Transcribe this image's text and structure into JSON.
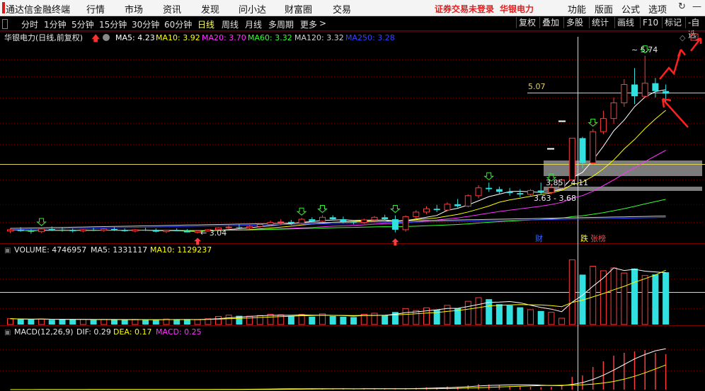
{
  "menubar": {
    "app_title": "通达信金融终端",
    "items": [
      "行情",
      "市场",
      "资讯",
      "发现",
      "问小达",
      "财富圈",
      "交易"
    ],
    "status_login": "证券交易未登录",
    "status_stock": "华银电力",
    "right_items": [
      "功能",
      "版面",
      "公式",
      "选项"
    ]
  },
  "toolbar": {
    "periods": [
      "分时",
      "1分钟",
      "5分钟",
      "15分钟",
      "30分钟",
      "60分钟",
      "日线",
      "周线",
      "月线",
      "多周期",
      "更多"
    ],
    "active_period": "日线",
    "more_arrow": ">",
    "buttons": [
      "复权",
      "叠加",
      "多股",
      "统计",
      "画线",
      "F10",
      "标记",
      "-自选"
    ]
  },
  "main_panel": {
    "title": "华银电力(日线,前复权)",
    "ma": [
      {
        "label": "MA5: 4.23",
        "color": "#ffffff"
      },
      {
        "label": "MA10: 3.92",
        "color": "#ffff00"
      },
      {
        "label": "MA20: 3.70",
        "color": "#ff33ff"
      },
      {
        "label": "MA60: 3.32",
        "color": "#33ff33"
      },
      {
        "label": "MA120: 3.32",
        "color": "#d0d0d0"
      },
      {
        "label": "MA250: 3.28",
        "color": "#3344ff"
      }
    ],
    "labels": {
      "high": "5.74",
      "low": "3.04",
      "hline_price": "5.07",
      "zone_upper": "3.85 - 4.11",
      "zone_lower": "3.63 - 3.68",
      "tag_fin": "财",
      "tag_die": "跌",
      "tag_zhang": "张榜"
    }
  },
  "volume_panel": {
    "label": "VOLUME: 4746957",
    "ma5": "MA5: 1331117",
    "ma10": "MA10: 1129237"
  },
  "macd_panel": {
    "label": "MACD(12,26,9)",
    "dif": "DIF: 0.29",
    "dea": "DEA: 0.17",
    "macd": "MACD: 0.25"
  },
  "colors": {
    "up": "#ff3b3b",
    "down": "#33e0e0",
    "ma5": "#ffffff",
    "ma10": "#ffff00",
    "ma20": "#ff33ff",
    "ma60": "#33ff33",
    "ma120": "#d0d0d0",
    "ma250": "#3344ff",
    "panel_border": "#7a0000",
    "signal": "#33ee33"
  },
  "chart_data": {
    "type": "candlestick",
    "candles": [
      [
        3.06,
        3.1,
        3.03,
        3.08
      ],
      [
        3.08,
        3.12,
        3.05,
        3.06
      ],
      [
        3.06,
        3.09,
        3.02,
        3.05
      ],
      [
        3.05,
        3.1,
        3.03,
        3.09
      ],
      [
        3.09,
        3.13,
        3.06,
        3.08
      ],
      [
        3.08,
        3.11,
        3.05,
        3.07
      ],
      [
        3.07,
        3.1,
        3.04,
        3.06
      ],
      [
        3.06,
        3.09,
        3.04,
        3.08
      ],
      [
        3.08,
        3.11,
        3.06,
        3.07
      ],
      [
        3.07,
        3.1,
        3.05,
        3.09
      ],
      [
        3.09,
        3.12,
        3.06,
        3.07
      ],
      [
        3.07,
        3.1,
        3.05,
        3.06
      ],
      [
        3.06,
        3.09,
        3.04,
        3.08
      ],
      [
        3.08,
        3.11,
        3.06,
        3.07
      ],
      [
        3.07,
        3.1,
        3.04,
        3.05
      ],
      [
        3.05,
        3.08,
        3.03,
        3.07
      ],
      [
        3.07,
        3.1,
        3.06,
        3.06
      ],
      [
        3.06,
        3.09,
        3.04,
        3.04
      ],
      [
        3.04,
        3.07,
        3.02,
        3.06
      ],
      [
        3.06,
        3.09,
        3.05,
        3.08
      ],
      [
        3.08,
        3.12,
        3.07,
        3.11
      ],
      [
        3.11,
        3.15,
        3.09,
        3.12
      ],
      [
        3.12,
        3.16,
        3.1,
        3.11
      ],
      [
        3.11,
        3.15,
        3.09,
        3.13
      ],
      [
        3.13,
        3.18,
        3.11,
        3.16
      ],
      [
        3.16,
        3.22,
        3.14,
        3.19
      ],
      [
        3.19,
        3.24,
        3.16,
        3.2
      ],
      [
        3.2,
        3.23,
        3.15,
        3.18
      ],
      [
        3.18,
        3.26,
        3.17,
        3.24
      ],
      [
        3.24,
        3.27,
        3.2,
        3.21
      ],
      [
        3.21,
        3.3,
        3.2,
        3.27
      ],
      [
        3.27,
        3.3,
        3.22,
        3.24
      ],
      [
        3.24,
        3.28,
        3.18,
        3.2
      ],
      [
        3.2,
        3.23,
        3.16,
        3.19
      ],
      [
        3.19,
        3.25,
        3.17,
        3.23
      ],
      [
        3.23,
        3.29,
        3.21,
        3.27
      ],
      [
        3.27,
        3.31,
        3.22,
        3.24
      ],
      [
        3.24,
        3.3,
        3.04,
        3.08
      ],
      [
        3.08,
        3.3,
        3.05,
        3.28
      ],
      [
        3.28,
        3.38,
        3.25,
        3.35
      ],
      [
        3.35,
        3.44,
        3.32,
        3.4
      ],
      [
        3.4,
        3.46,
        3.35,
        3.38
      ],
      [
        3.38,
        3.5,
        3.36,
        3.47
      ],
      [
        3.47,
        3.55,
        3.42,
        3.44
      ],
      [
        3.44,
        3.62,
        3.42,
        3.6
      ],
      [
        3.6,
        3.76,
        3.56,
        3.72
      ],
      [
        3.72,
        3.8,
        3.66,
        3.7
      ],
      [
        3.7,
        3.74,
        3.62,
        3.66
      ],
      [
        3.66,
        3.72,
        3.6,
        3.64
      ],
      [
        3.64,
        3.7,
        3.58,
        3.62
      ],
      [
        3.62,
        3.7,
        3.6,
        3.68
      ],
      [
        3.68,
        3.8,
        3.62,
        3.65
      ],
      [
        3.65,
        3.78,
        3.62,
        3.72
      ],
      [
        3.72,
        3.86,
        3.7,
        3.84
      ],
      [
        3.84,
        4.48,
        3.84,
        4.48
      ],
      [
        4.48,
        4.5,
        4.02,
        4.1
      ],
      [
        4.1,
        4.62,
        4.08,
        4.58
      ],
      [
        4.58,
        4.9,
        4.54,
        4.78
      ],
      [
        4.78,
        5.1,
        4.7,
        5.02
      ],
      [
        5.02,
        5.38,
        4.96,
        5.3
      ],
      [
        5.3,
        5.55,
        5.0,
        5.12
      ],
      [
        5.12,
        5.74,
        5.1,
        5.32
      ],
      [
        5.32,
        5.4,
        5.1,
        5.2
      ],
      [
        5.2,
        5.3,
        5.02,
        5.16
      ]
    ],
    "volume": [
      6.8,
      6.2,
      5.9,
      6.5,
      5.6,
      6.0,
      5.8,
      6.1,
      5.3,
      5.9,
      5.7,
      5.5,
      6.0,
      5.6,
      5.2,
      6.4,
      5.9,
      6.3,
      5.6,
      6.8,
      9.5,
      11.0,
      10.2,
      9.8,
      10.6,
      12.0,
      11.4,
      10.1,
      11.8,
      9.2,
      12.5,
      10.0,
      9.1,
      8.7,
      12.0,
      13.2,
      11.1,
      14.6,
      18.7,
      16.3,
      19.5,
      17.2,
      22.4,
      19.0,
      27.1,
      31.3,
      29.6,
      23.7,
      22.3,
      20.1,
      17.4,
      15.8,
      14.3,
      7.4,
      75.5,
      58.2,
      68.0,
      62.7,
      66.0,
      60.1,
      65.3,
      57.2,
      58.4,
      61.0
    ],
    "macd_hist": [
      0.0,
      0.0,
      0.0,
      0.001,
      0.001,
      0.0,
      0.0,
      0.001,
      0.0,
      0.001,
      0.0,
      0.0,
      0.001,
      0.0,
      0.0,
      0.001,
      0.0,
      0.0,
      0.001,
      0.001,
      0.002,
      0.003,
      0.003,
      0.004,
      0.005,
      0.006,
      0.006,
      0.005,
      0.006,
      0.005,
      0.006,
      0.005,
      0.004,
      0.004,
      0.006,
      0.007,
      0.006,
      0.004,
      0.008,
      0.012,
      0.016,
      0.015,
      0.022,
      0.02,
      0.03,
      0.04,
      0.036,
      0.03,
      0.026,
      0.022,
      0.02,
      0.018,
      0.02,
      0.03,
      0.09,
      0.1,
      0.16,
      0.2,
      0.24,
      0.26,
      0.27,
      0.28,
      0.26,
      0.25
    ],
    "price_ylim": [
      2.96,
      5.9
    ]
  }
}
